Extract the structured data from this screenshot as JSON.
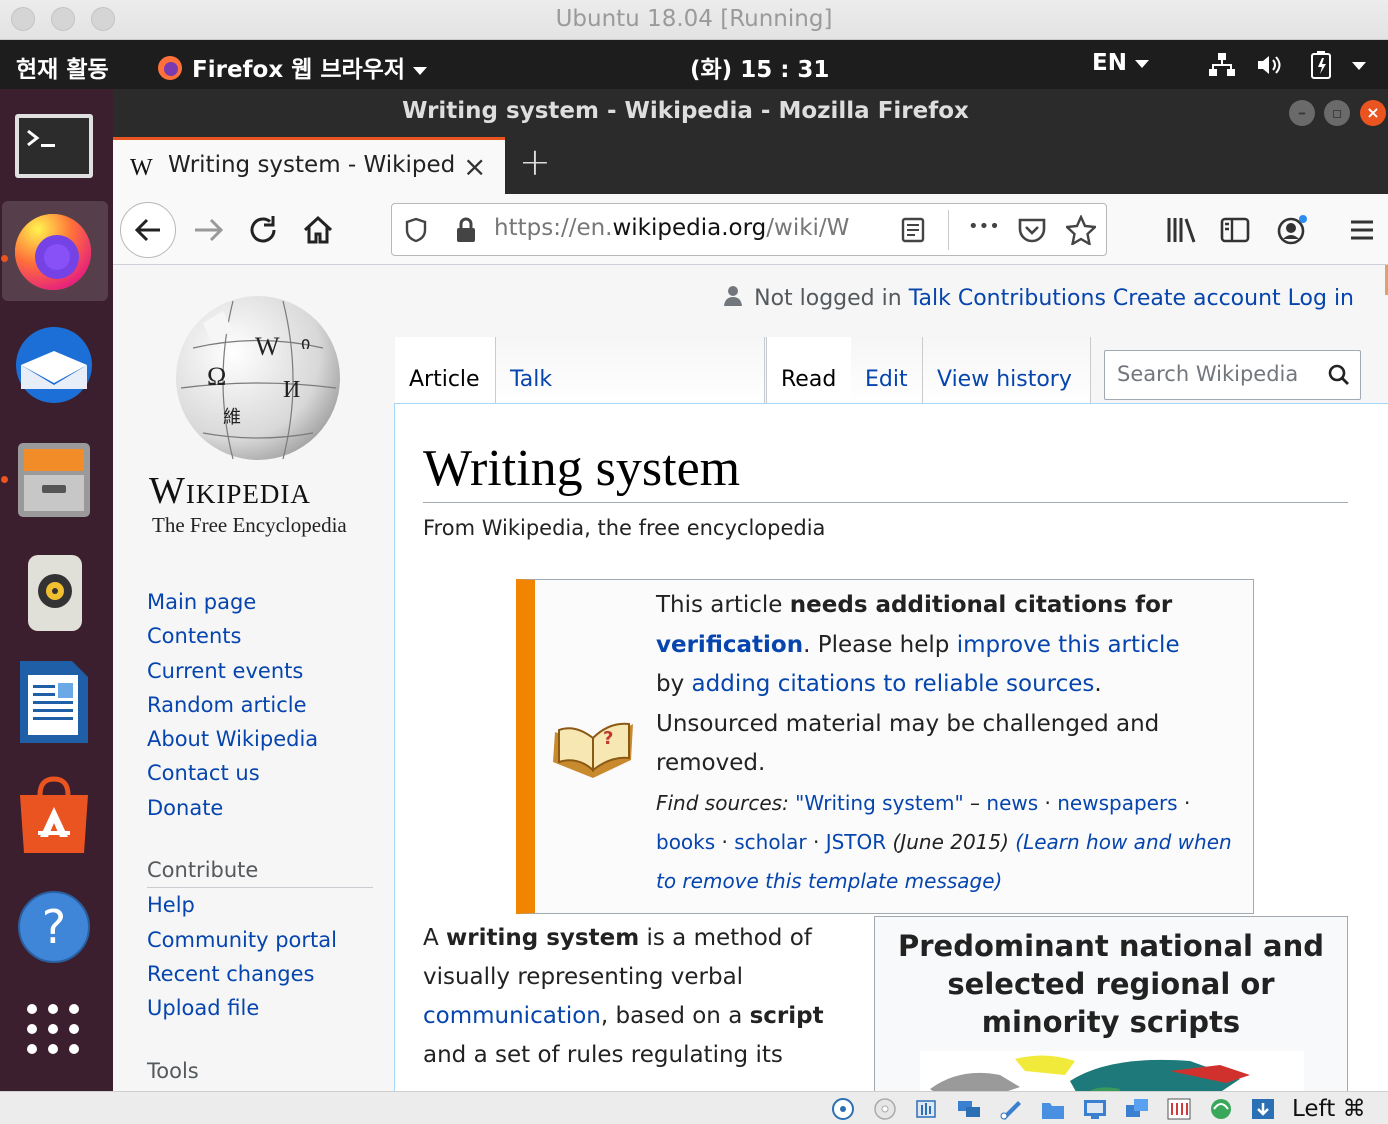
{
  "host": {
    "title": "Ubuntu 18.04 [Running]",
    "hostkey_label": "Left ⌘"
  },
  "panel": {
    "activities": "현재 활동",
    "app_menu": "Firefox 웹 브라우저",
    "clock": "(화) 15 : 31",
    "lang": "EN"
  },
  "dock": {
    "items": [
      "terminal-icon",
      "firefox-icon",
      "thunderbird-icon",
      "files-icon",
      "rhythmbox-icon",
      "libreoffice-writer-icon",
      "software-center-icon",
      "help-icon",
      "show-apps-icon"
    ]
  },
  "firefox": {
    "window_title": "Writing system - Wikipedia - Mozilla Firefox",
    "tab_title": "Writing system - Wikiped",
    "url_prefix": "https://en.",
    "url_domain": "wikipedia.org",
    "url_path": "/wiki/W",
    "overflow": "•••"
  },
  "wiki": {
    "logo_word": "Wikipedia",
    "logo_tagline": "The Free Encyclopedia",
    "personal": {
      "status": "Not logged in",
      "links": [
        "Talk",
        "Contributions",
        "Create account",
        "Log in"
      ]
    },
    "tabs": {
      "article": "Article",
      "talk": "Talk",
      "read": "Read",
      "edit": "Edit",
      "history": "View history"
    },
    "search_placeholder": "Search Wikipedia",
    "nav": [
      "Main page",
      "Contents",
      "Current events",
      "Random article",
      "About Wikipedia",
      "Contact us",
      "Donate"
    ],
    "contribute_heading": "Contribute",
    "contribute": [
      "Help",
      "Community portal",
      "Recent changes",
      "Upload file"
    ],
    "tools_heading": "Tools",
    "title": "Writing system",
    "tagline": "From Wikipedia, the free encyclopedia",
    "ambox": {
      "t1": "This article ",
      "t2": "needs additional citations for ",
      "t3": "verification",
      "t4": ". Please help ",
      "t5": "improve this article",
      "t6": "by ",
      "t7": "adding citations to reliable sources",
      "t8": ".",
      "t9": "Unsourced material may be challenged and removed.",
      "find_label": "Find sources:",
      "find_query": "\"Writing system\"",
      "dash": " – ",
      "sources": [
        "news",
        "newspapers",
        "books",
        "scholar",
        "JSTOR"
      ],
      "date": "(June 2015)",
      "learn": "(Learn how and when to remove this template message)"
    },
    "body": {
      "p1": "A ",
      "p2": "writing system",
      "p3": " is a method of visually representing verbal ",
      "p4": "communication",
      "p5": ", based on a ",
      "p6": "script",
      "p7": " and a set of rules regulating its"
    },
    "infobox_title": "Predominant national and selected regional or minority scripts"
  },
  "colors": {
    "link": "#0645ad",
    "ambox_border": "#f28500",
    "ubuntu_orange": "#e95420",
    "dock_bg": "#3c1f2e"
  }
}
